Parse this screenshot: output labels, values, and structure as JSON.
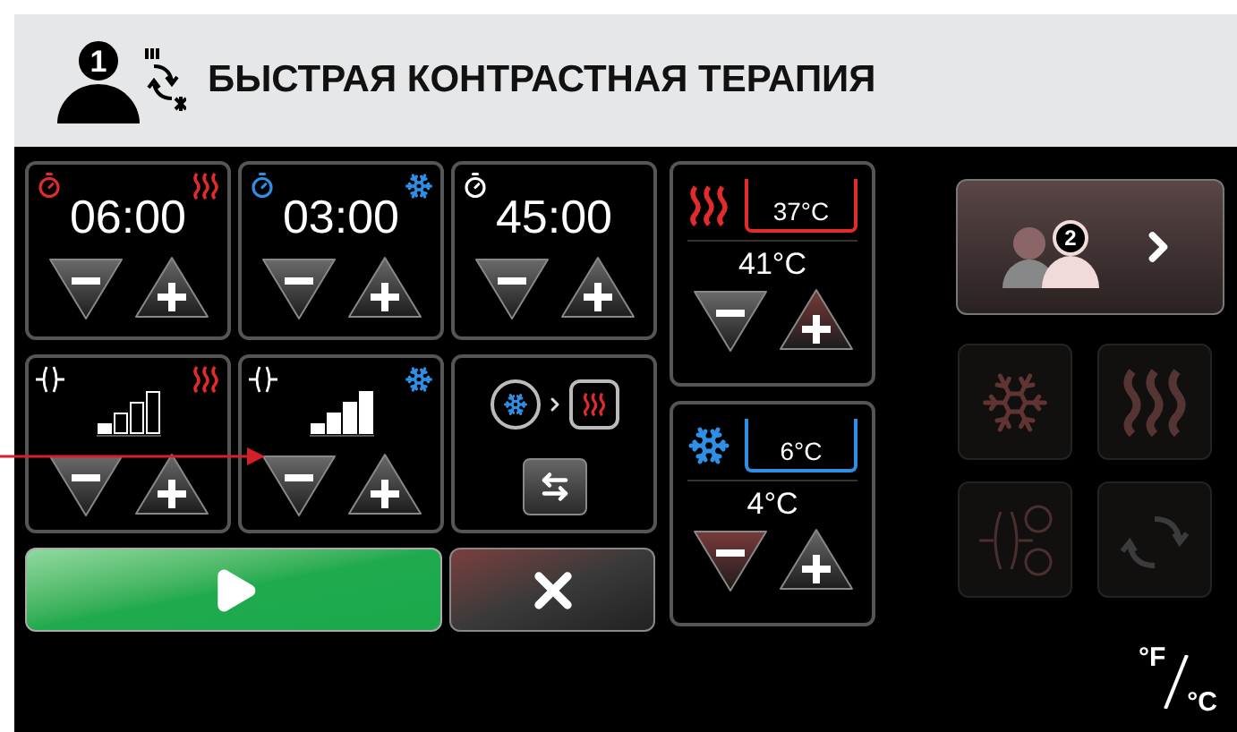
{
  "header": {
    "user_number": "1",
    "title": "БЫСТРАЯ КОНТРАСТНАЯ ТЕРАПИЯ"
  },
  "timers": [
    {
      "kind": "heat",
      "time": "06:00"
    },
    {
      "kind": "cold",
      "time": "03:00"
    },
    {
      "kind": "total",
      "time": "45:00"
    }
  ],
  "intensities": [
    {
      "kind": "heat",
      "level": 0.25
    },
    {
      "kind": "cold",
      "level": 1
    }
  ],
  "sequence": [
    {
      "kind": "cold"
    },
    {
      "kind": "heat"
    }
  ],
  "temperatures": [
    {
      "kind": "heat",
      "water": "37°C",
      "setpoint": "41°C"
    },
    {
      "kind": "cold",
      "water": "6°C",
      "setpoint": "4°C"
    }
  ],
  "next_user": {
    "number": "2"
  },
  "modes": [
    {
      "kind": "cold",
      "disabled": true
    },
    {
      "kind": "heat",
      "disabled": true
    },
    {
      "kind": "compression",
      "disabled": true
    },
    {
      "kind": "contrast",
      "disabled": true
    }
  ],
  "units": [
    "°F",
    "°C"
  ]
}
